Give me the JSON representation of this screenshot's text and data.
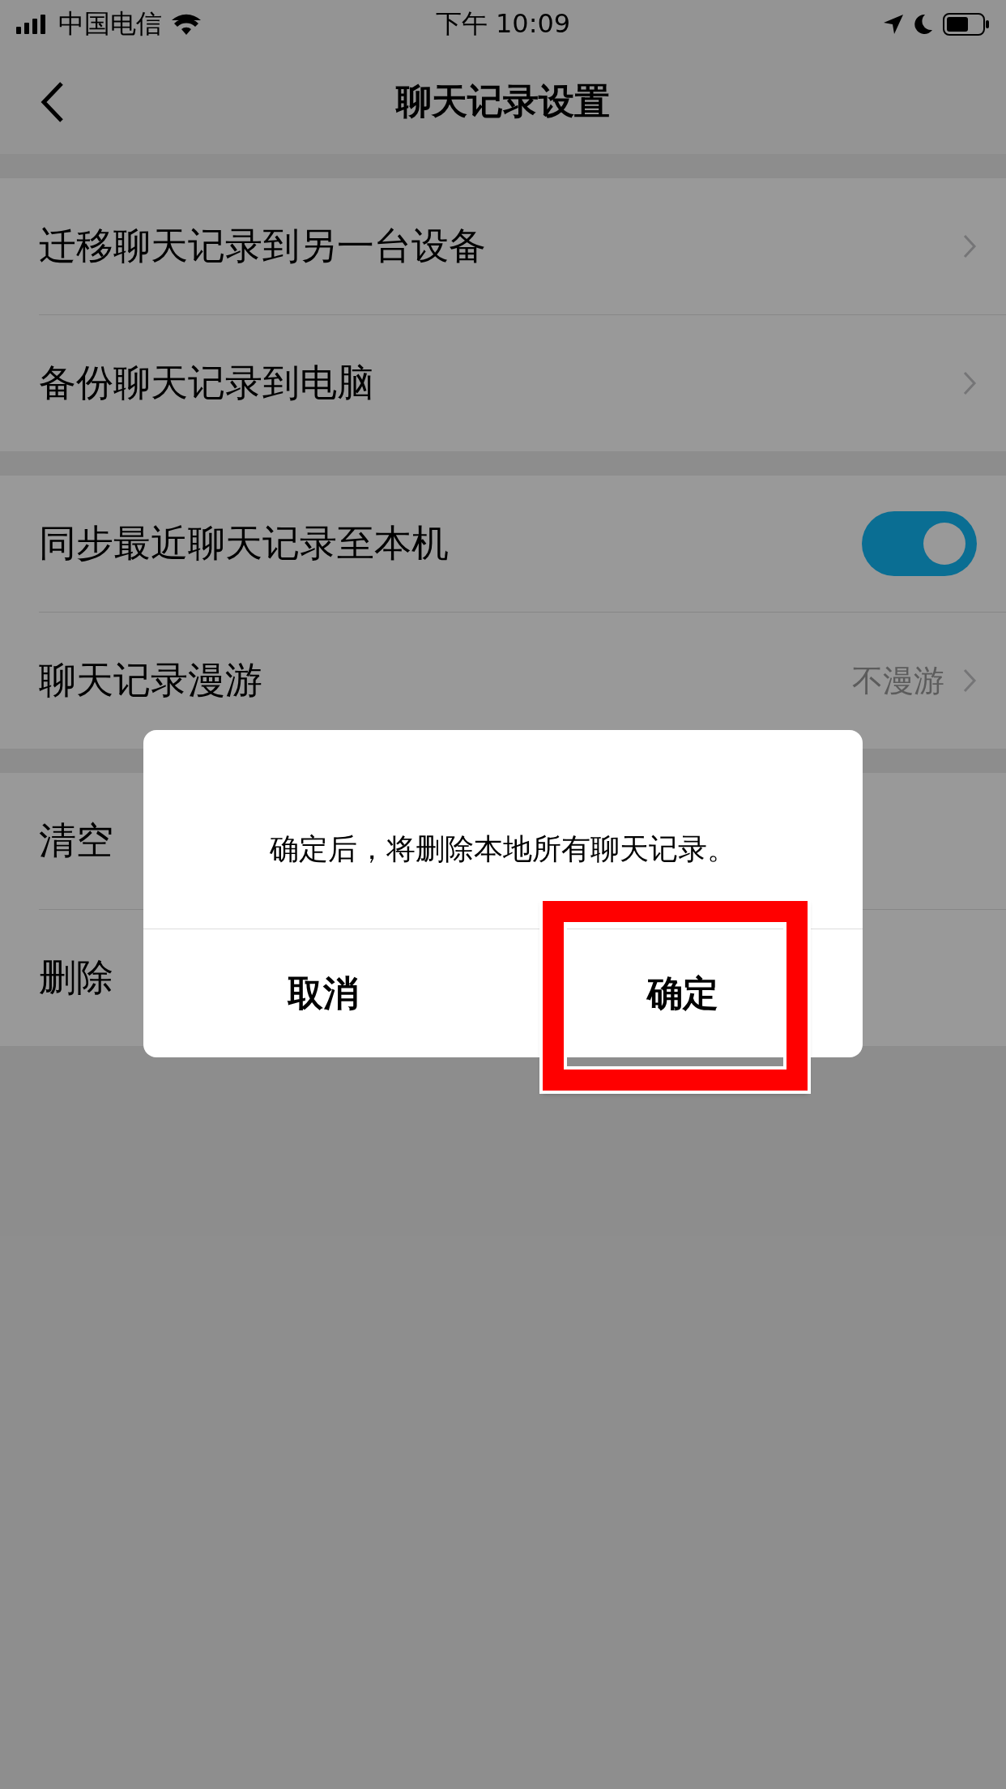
{
  "status_bar": {
    "carrier": "中国电信",
    "time": "下午 10:09"
  },
  "nav": {
    "title": "聊天记录设置"
  },
  "groups": [
    {
      "rows": [
        {
          "kind": "link",
          "label": "迁移聊天记录到另一台设备"
        },
        {
          "kind": "link",
          "label": "备份聊天记录到电脑"
        }
      ]
    },
    {
      "rows": [
        {
          "kind": "toggle",
          "label": "同步最近聊天记录至本机",
          "on": true
        },
        {
          "kind": "link",
          "label": "聊天记录漫游",
          "value": "不漫游"
        }
      ]
    },
    {
      "rows": [
        {
          "kind": "plain",
          "label": "清空"
        },
        {
          "kind": "plain",
          "label": "删除"
        }
      ]
    }
  ],
  "dialog": {
    "message": "确定后，将删除本地所有聊天记录。",
    "buttons": [
      {
        "label": "取消",
        "highlighted": false
      },
      {
        "label": "确定",
        "highlighted": true
      }
    ]
  }
}
